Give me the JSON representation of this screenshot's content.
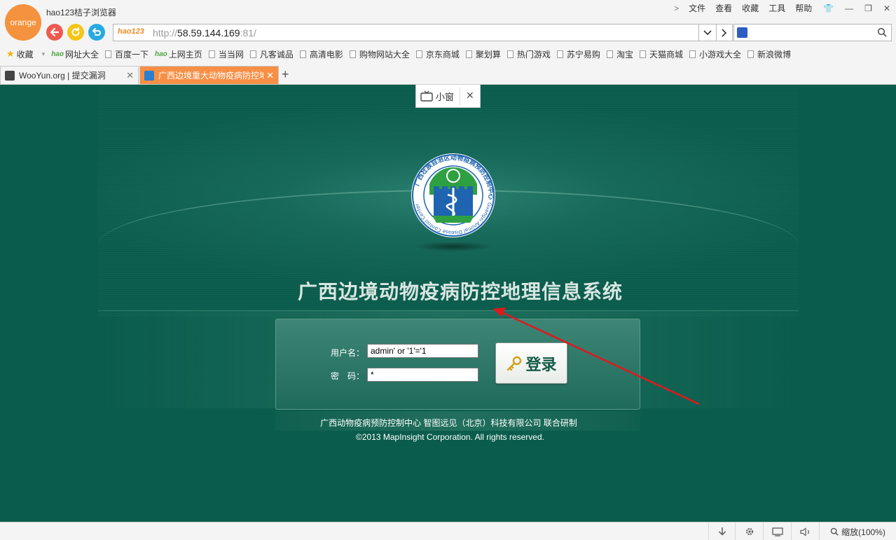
{
  "browser": {
    "logo_text": "orange",
    "title": "hao123桔子浏览器",
    "menu": [
      "文件",
      "查看",
      "收藏",
      "工具",
      "帮助"
    ],
    "address": {
      "logo": "hao123",
      "scheme": "http://",
      "host": "58.59.144.169",
      "port_path": ":81/"
    },
    "bookmarks": [
      {
        "label": "收藏",
        "icon": "star-icon"
      },
      {
        "label": "网址大全",
        "icon": "hao-icon"
      },
      {
        "label": "百度一下",
        "icon": "page-icon"
      },
      {
        "label": "上网主页",
        "icon": "hao-icon"
      },
      {
        "label": "当当网",
        "icon": "page-icon"
      },
      {
        "label": "凡客诚品",
        "icon": "page-icon"
      },
      {
        "label": "高清电影",
        "icon": "page-icon"
      },
      {
        "label": "购物网站大全",
        "icon": "page-icon"
      },
      {
        "label": "京东商城",
        "icon": "page-icon"
      },
      {
        "label": "聚划算",
        "icon": "page-icon"
      },
      {
        "label": "热门游戏",
        "icon": "page-icon"
      },
      {
        "label": "苏宁易购",
        "icon": "page-icon"
      },
      {
        "label": "淘宝",
        "icon": "page-icon"
      },
      {
        "label": "天猫商城",
        "icon": "page-icon"
      },
      {
        "label": "小游戏大全",
        "icon": "page-icon"
      },
      {
        "label": "新浪微博",
        "icon": "page-icon"
      }
    ],
    "tabs": [
      {
        "label": "WooYun.org | 提交漏洞",
        "active": false
      },
      {
        "label": "广西边境重大动物疫病防控地",
        "active": true
      }
    ],
    "status": {
      "zoom": "缩放(100%)"
    }
  },
  "popup": {
    "label": "小窗"
  },
  "page": {
    "emblem_ring_text": "广西壮族自治区动物疫病预防控制中心",
    "emblem_ring_text_en": "Guangxi Animal Disease Control Center",
    "system_title": "广西边境动物疫病防控地理信息系统",
    "login": {
      "username_label": "用户名：",
      "password_label": "密　码：",
      "username_value": "admin' or '1'='1",
      "password_value": "*",
      "button_label": "登录"
    },
    "credits": "广西动物疫病预防控制中心  智图远见（北京）科技有限公司  联合研制",
    "copyright": "©2013 MapInsight Corporation. All rights reserved."
  },
  "colors": {
    "page_bg": "#0a5c4c",
    "tab_active": "#f78f45",
    "annotation_arrow": "#e0191c",
    "emblem_blue": "#1f64b0",
    "emblem_green": "#2ea043"
  }
}
